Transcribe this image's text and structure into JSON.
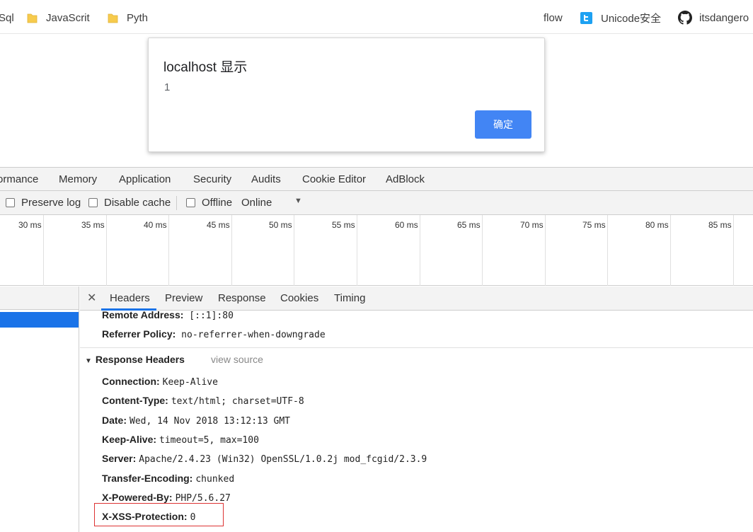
{
  "bookmarks": [
    {
      "label": "Sql",
      "icon": "folder-icon"
    },
    {
      "label": "JavaScrit",
      "icon": "folder-icon"
    },
    {
      "label": "Pyth",
      "icon": "folder-icon"
    },
    {
      "label": "flow",
      "icon": ""
    },
    {
      "label": "Unicode安全",
      "icon": "twitter-icon"
    },
    {
      "label": "itsdangero",
      "icon": "github-icon"
    }
  ],
  "dialog": {
    "title": "localhost 显示",
    "message": "1",
    "ok_label": "确定"
  },
  "devtools": {
    "tabs": [
      "ormance",
      "Memory",
      "Application",
      "Security",
      "Audits",
      "Cookie Editor",
      "AdBlock"
    ],
    "toolbar": {
      "preserve_log": "Preserve log",
      "disable_cache": "Disable cache",
      "offline": "Offline",
      "throttle": "Online"
    },
    "timeline_ticks": [
      "30 ms",
      "35 ms",
      "40 ms",
      "45 ms",
      "50 ms",
      "55 ms",
      "60 ms",
      "65 ms",
      "70 ms",
      "75 ms",
      "80 ms",
      "85 ms"
    ],
    "detail_tabs": [
      "Headers",
      "Preview",
      "Response",
      "Cookies",
      "Timing"
    ],
    "general": [
      {
        "key": "Remote Address:",
        "value": "[::1]:80"
      },
      {
        "key": "Referrer Policy:",
        "value": "no-referrer-when-downgrade"
      }
    ],
    "response_section": {
      "title": "Response Headers",
      "view_source": "view source"
    },
    "response_headers": [
      {
        "key": "Connection:",
        "value": "Keep-Alive"
      },
      {
        "key": "Content-Type:",
        "value": "text/html; charset=UTF-8"
      },
      {
        "key": "Date:",
        "value": "Wed, 14 Nov 2018 13:12:13 GMT"
      },
      {
        "key": "Keep-Alive:",
        "value": "timeout=5, max=100"
      },
      {
        "key": "Server:",
        "value": "Apache/2.4.23 (Win32) OpenSSL/1.0.2j mod_fcgid/2.3.9"
      },
      {
        "key": "Transfer-Encoding:",
        "value": "chunked"
      },
      {
        "key": "X-Powered-By:",
        "value": "PHP/5.6.27"
      },
      {
        "key": "X-XSS-Protection:",
        "value": "0"
      }
    ],
    "colors": {
      "accent": "#1a73e8",
      "highlight": "#dd3333",
      "dialog_button": "#4285f4"
    }
  }
}
